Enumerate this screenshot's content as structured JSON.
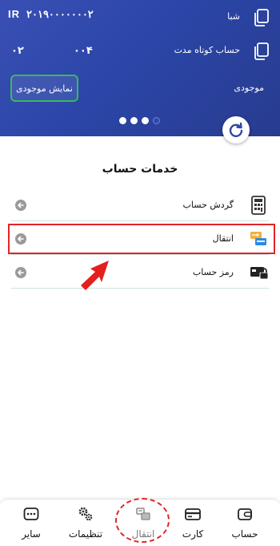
{
  "card": {
    "sheba_label": "شبا",
    "sheba_prefix": "IR",
    "sheba_number": "۲۰۱۹۰۰۰۰۰۰۰۲",
    "short_term_label": "حساب کوتاه مدت",
    "short_term_branch": "۰۰۴",
    "short_term_code": "۰۲",
    "balance_label": "موجودی",
    "show_balance_button": "نمایش موجودی",
    "carousel_page": 4,
    "carousel_total": 4
  },
  "services": {
    "title": "خدمات حساب",
    "items": [
      {
        "label": "گردش حساب",
        "icon": "statement-icon"
      },
      {
        "label": "انتقال",
        "icon": "transfer-cards-icon",
        "highlighted": true
      },
      {
        "label": "رمز حساب",
        "icon": "account-password-icon"
      }
    ]
  },
  "nav": {
    "items": [
      {
        "label": "حساب",
        "icon": "wallet-icon"
      },
      {
        "label": "کارت",
        "icon": "card-icon"
      },
      {
        "label": "انتقال",
        "icon": "transfer-icon",
        "highlighted": true
      },
      {
        "label": "تنظیمات",
        "icon": "gears-icon"
      },
      {
        "label": "سایر",
        "icon": "more-icon"
      }
    ]
  },
  "colors": {
    "card_gradient_start": "#3a4fb5",
    "card_gradient_end": "#283b8f",
    "balance_button_border": "#3bb85a",
    "annotation_red": "#e3232a",
    "divider": "#cfe3e1"
  }
}
